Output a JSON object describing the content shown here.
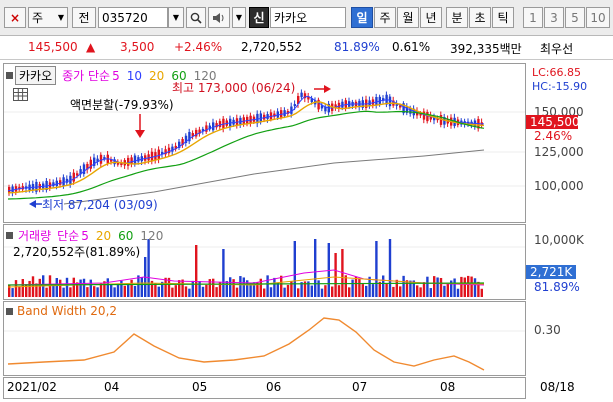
{
  "toolbar": {
    "cross_label": "×",
    "type_select": "주",
    "all_label": "전",
    "code_value": "035720",
    "new_badge": "신",
    "stock_name": "카카오",
    "period_tabs": [
      "일",
      "주",
      "월",
      "년",
      "분",
      "초",
      "틱"
    ],
    "period_active": "일",
    "interval_buttons": [
      "1",
      "3",
      "5",
      "10"
    ]
  },
  "quote": {
    "price": "145,500",
    "arrow": "▲",
    "change": "3,500",
    "change_pct": "+2.46%",
    "volume": "2,720,552",
    "vol_ratio": "81.89%",
    "turnover": "0.61%",
    "amount": "392,335백만",
    "tag": "최우선"
  },
  "price_pane": {
    "stock_label": "카카오",
    "ma_title": "종가 단순",
    "ma_periods": [
      "5",
      "10",
      "20",
      "60",
      "120"
    ],
    "ma_colors": [
      "#e000e0",
      "#3040ff",
      "#e8a600",
      "#12a012",
      "#7a7a7a"
    ],
    "lc_label": "LC:66.85",
    "hc_label": "HC:-15.90",
    "annotation_split": "액면분할(-79.93%)",
    "annotation_high": "최고 173,000 (06/24)",
    "annotation_low": "최저 87,204 (03/09)",
    "axis_prices": [
      "150,000",
      "125,000",
      "100,000"
    ],
    "current_price_tag": "145,500",
    "current_pct_tag": "2.46%"
  },
  "volume_pane": {
    "title": "거래량",
    "ma_title": "단순",
    "ma_periods": [
      "5",
      "20",
      "60",
      "120"
    ],
    "ma_colors": [
      "#e000e0",
      "#e8a600",
      "#12a012",
      "#7a7a7a"
    ],
    "value_label": "2,720,552주(81.89%)",
    "axis_label": "10,000K",
    "current_tag": "2,721K",
    "current_pct": "81.89%"
  },
  "bw_pane": {
    "title": "Band Width 20,2",
    "axis_label": "0.30"
  },
  "date_axis": {
    "labels": [
      "2021/02",
      "04",
      "05",
      "06",
      "07",
      "08"
    ],
    "right_label": "08/18"
  }
}
